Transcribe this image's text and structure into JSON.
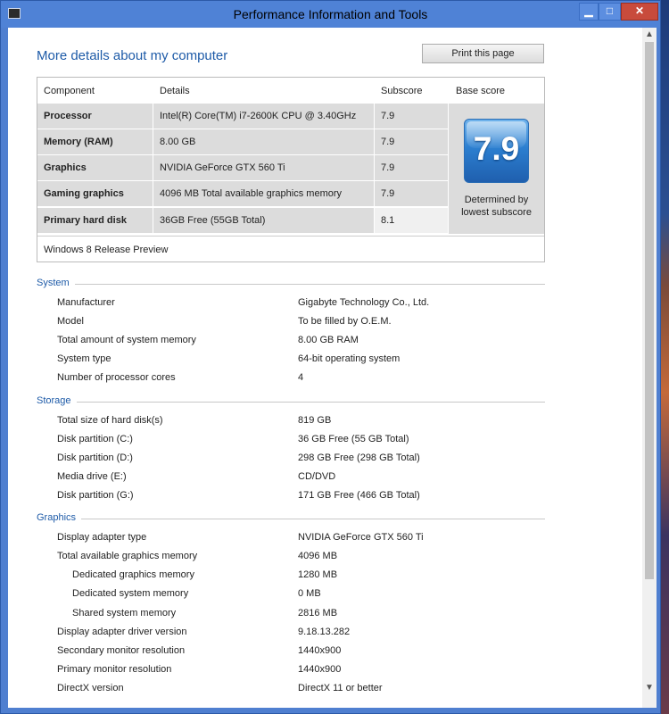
{
  "window": {
    "title": "Performance Information and Tools"
  },
  "page": {
    "heading": "More details about my computer",
    "print_button": "Print this page"
  },
  "scores": {
    "headers": [
      "Component",
      "Details",
      "Subscore",
      "Base score"
    ],
    "rows": [
      {
        "component": "Processor",
        "details": "Intel(R) Core(TM) i7-2600K CPU @ 3.40GHz",
        "subscore": "7.9"
      },
      {
        "component": "Memory (RAM)",
        "details": "8.00 GB",
        "subscore": "7.9"
      },
      {
        "component": "Graphics",
        "details": "NVIDIA GeForce GTX 560 Ti",
        "subscore": "7.9"
      },
      {
        "component": "Gaming graphics",
        "details": "4096 MB Total available graphics memory",
        "subscore": "7.9"
      },
      {
        "component": "Primary hard disk",
        "details": "36GB Free (55GB Total)",
        "subscore": "8.1"
      }
    ],
    "base_score": "7.9",
    "determined_line1": "Determined by",
    "determined_line2": "lowest subscore",
    "footer": "Windows 8 Release Preview"
  },
  "sections": {
    "system": {
      "title": "System",
      "items": [
        {
          "label": "Manufacturer",
          "value": "Gigabyte Technology Co., Ltd."
        },
        {
          "label": "Model",
          "value": "To be filled by O.E.M."
        },
        {
          "label": "Total amount of system memory",
          "value": "8.00 GB RAM"
        },
        {
          "label": "System type",
          "value": "64-bit operating system"
        },
        {
          "label": "Number of processor cores",
          "value": "4"
        }
      ]
    },
    "storage": {
      "title": "Storage",
      "items": [
        {
          "label": "Total size of hard disk(s)",
          "value": "819 GB"
        },
        {
          "label": "Disk partition (C:)",
          "value": "36 GB Free (55 GB Total)"
        },
        {
          "label": "Disk partition (D:)",
          "value": "298 GB Free (298 GB Total)"
        },
        {
          "label": "Media drive (E:)",
          "value": "CD/DVD"
        },
        {
          "label": "Disk partition (G:)",
          "value": "171 GB Free (466 GB Total)"
        }
      ]
    },
    "graphics": {
      "title": "Graphics",
      "items": [
        {
          "label": "Display adapter type",
          "value": "NVIDIA GeForce GTX 560 Ti"
        },
        {
          "label": "Total available graphics memory",
          "value": "4096 MB"
        },
        {
          "label": "Dedicated graphics memory",
          "value": "1280 MB"
        },
        {
          "label": "Dedicated system memory",
          "value": "0 MB"
        },
        {
          "label": "Shared system memory",
          "value": "2816 MB"
        },
        {
          "label": "Display adapter driver version",
          "value": "9.18.13.282"
        },
        {
          "label": "Secondary monitor resolution",
          "value": "1440x900"
        },
        {
          "label": "Primary monitor resolution",
          "value": "1440x900"
        },
        {
          "label": "DirectX version",
          "value": "DirectX 11 or better"
        }
      ]
    }
  }
}
